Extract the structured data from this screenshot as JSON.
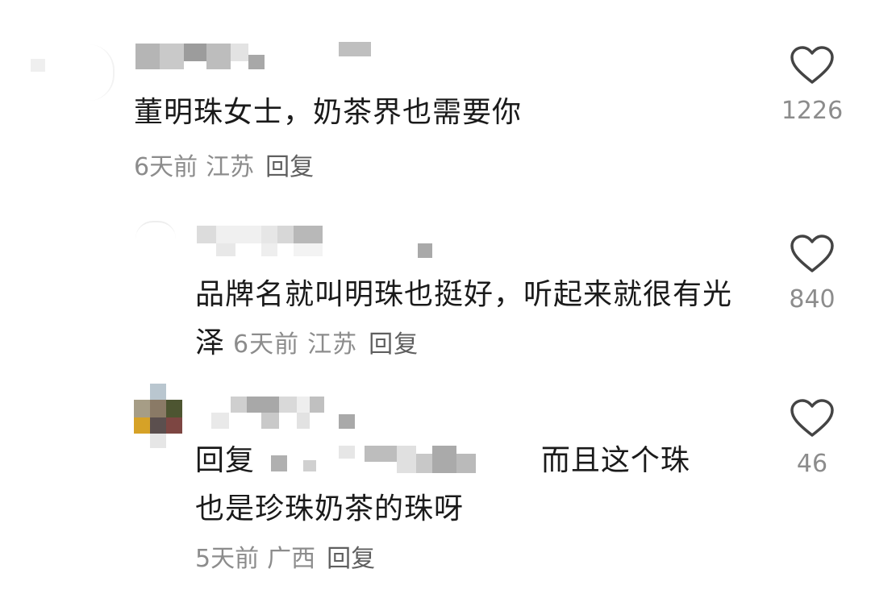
{
  "comments": [
    {
      "text": "董明珠女士，奶茶界也需要你",
      "time": "6天前",
      "location": "江苏",
      "reply_label": "回复",
      "likes": "1226"
    },
    {
      "text": "品牌名就叫明珠也挺好，听起来就很有光泽",
      "time": "6天前",
      "location": "江苏",
      "reply_label": "回复",
      "likes": "840"
    },
    {
      "reply_prefix": "回复",
      "text_after_mention": "而且这个珠",
      "text_line2": "也是珍珠奶茶的珠呀",
      "time": "5天前",
      "location": "广西",
      "reply_label": "回复",
      "likes": "46"
    }
  ],
  "colors": {
    "text": "#1a1a1a",
    "meta": "#8c8c8c",
    "icon": "#444444"
  },
  "icons": {
    "like": "heart-outline-icon"
  }
}
